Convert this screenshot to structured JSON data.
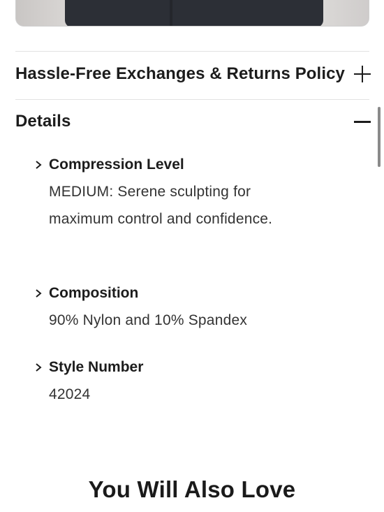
{
  "hero": {
    "image_icon": "product-photo"
  },
  "returns_accordion": {
    "title": "Hassle-Free Exchanges & Returns Policy",
    "toggle_icon": "plus-icon",
    "expanded": false
  },
  "details_accordion": {
    "title": "Details",
    "toggle_icon": "minus-icon",
    "expanded": true,
    "items": [
      {
        "title": "Compression Level",
        "text": "MEDIUM: Serene sculpting for maximum control and confidence.",
        "icon": "chevron-right-icon"
      },
      {
        "title": "Composition",
        "text": "90% Nylon and 10% Spandex",
        "icon": "chevron-right-icon"
      },
      {
        "title": "Style Number",
        "text": "42024",
        "icon": "chevron-right-icon"
      }
    ]
  },
  "recommendations": {
    "heading": "You Will Also Love"
  },
  "colors": {
    "text": "#1c1c1c",
    "body_text": "#333333",
    "divider": "#e2e2e2",
    "garment": "#2c2f36"
  }
}
